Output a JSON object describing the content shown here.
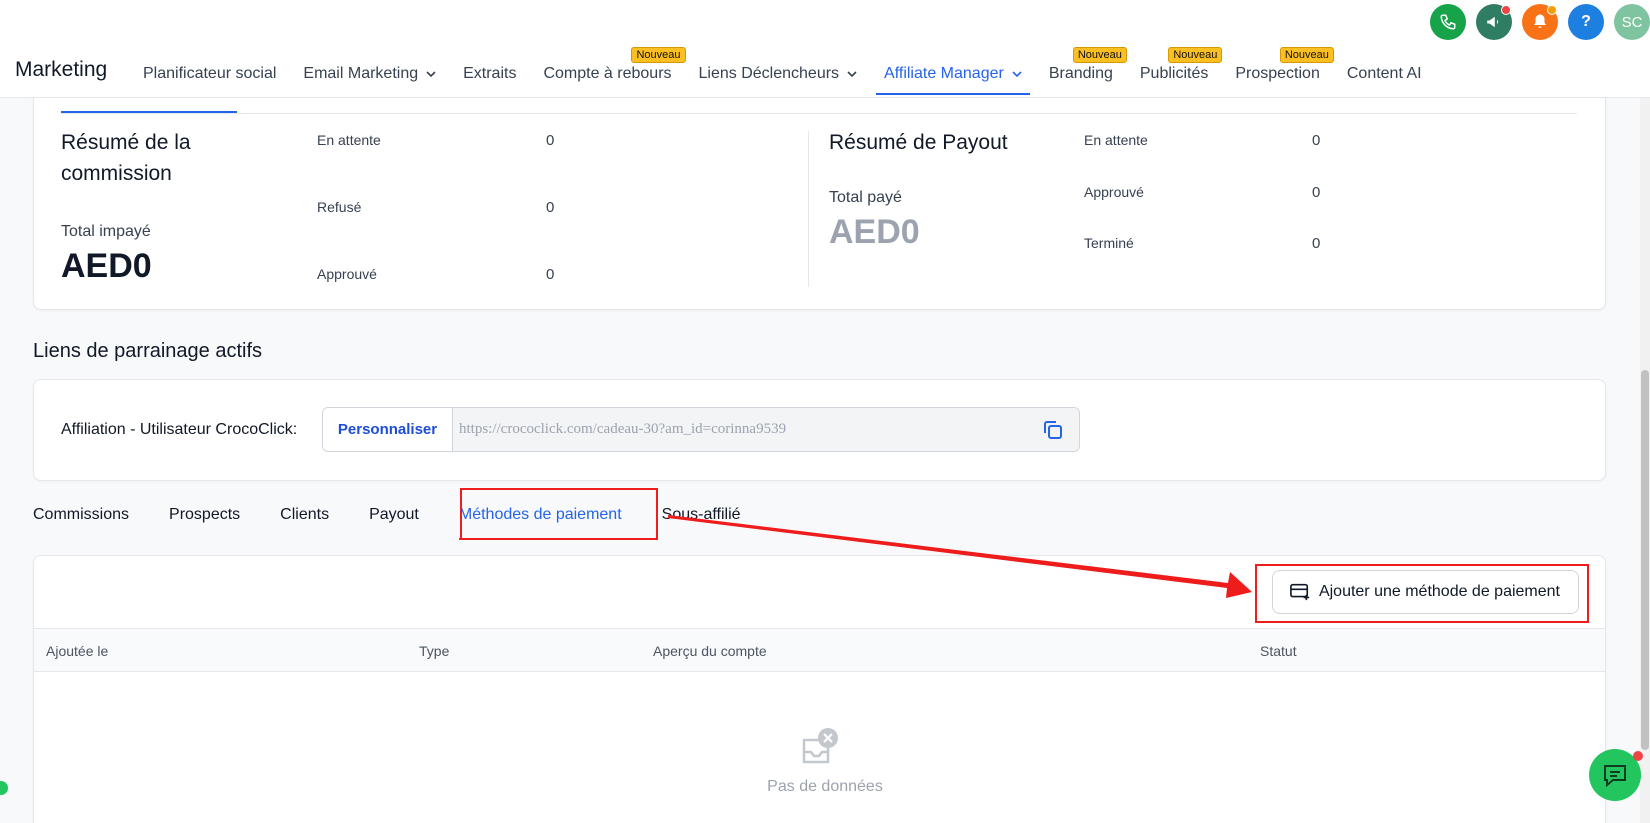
{
  "header": {
    "app_title": "Marketing",
    "nav": [
      {
        "label": "Planificateur social",
        "badge": "",
        "has_chevron": false,
        "active": false
      },
      {
        "label": "Email Marketing",
        "badge": "",
        "has_chevron": true,
        "active": false
      },
      {
        "label": "Extraits",
        "badge": "",
        "has_chevron": false,
        "active": false
      },
      {
        "label": "Compte à rebours",
        "badge": "Nouveau",
        "has_chevron": false,
        "active": false
      },
      {
        "label": "Liens Déclencheurs",
        "badge": "",
        "has_chevron": true,
        "active": false
      },
      {
        "label": "Affiliate Manager",
        "badge": "",
        "has_chevron": true,
        "active": true
      },
      {
        "label": "Branding",
        "badge": "Nouveau",
        "has_chevron": false,
        "active": false
      },
      {
        "label": "Publicités",
        "badge": "Nouveau",
        "has_chevron": false,
        "active": false
      },
      {
        "label": "Prospection",
        "badge": "Nouveau",
        "has_chevron": false,
        "active": false
      },
      {
        "label": "Content AI",
        "badge": "",
        "has_chevron": false,
        "active": false
      }
    ],
    "top_icons": [
      {
        "name": "phone-icon",
        "color": "#16a34a"
      },
      {
        "name": "megaphone-icon",
        "color": "#2f7d63"
      },
      {
        "name": "bell-icon",
        "color": "#f97316"
      },
      {
        "name": "help-icon",
        "color": "#1d7fe0",
        "glyph": "?"
      },
      {
        "name": "avatar",
        "color": "#7fc4a0",
        "glyph": "SC"
      }
    ]
  },
  "commission_summary": {
    "title": "Résumé de la commission",
    "total_label": "Total impayé",
    "total_value": "AED0",
    "rows": [
      {
        "label": "En attente",
        "value": "0"
      },
      {
        "label": "Refusé",
        "value": "0"
      },
      {
        "label": "Approuvé",
        "value": "0"
      }
    ]
  },
  "payout_summary": {
    "title": "Résumé de Payout",
    "total_label": "Total payé",
    "total_value": "AED0",
    "rows": [
      {
        "label": "En attente",
        "value": "0"
      },
      {
        "label": "Approuvé",
        "value": "0"
      },
      {
        "label": "Terminé",
        "value": "0"
      }
    ]
  },
  "referral": {
    "section_title": "Liens de parrainage actifs",
    "label": "Affiliation - Utilisateur CrocoClick:",
    "customize_label": "Personnaliser",
    "link": "https://crococlick.com/cadeau-30?am_id=corinna9539"
  },
  "tabs": [
    {
      "label": "Commissions",
      "active": false
    },
    {
      "label": "Prospects",
      "active": false
    },
    {
      "label": "Clients",
      "active": false
    },
    {
      "label": "Payout",
      "active": false
    },
    {
      "label": "Méthodes de paiement",
      "active": true
    },
    {
      "label": "Sous-affilié",
      "active": false
    }
  ],
  "payment_methods": {
    "add_button_label": "Ajouter une méthode de paiement",
    "columns": [
      "Ajoutée le",
      "Type",
      "Aperçu du compte",
      "Statut"
    ],
    "empty_text": "Pas de données"
  },
  "colors": {
    "accent": "#2563eb",
    "annotation": "#ef1c1c",
    "badge": "#fbbf24"
  }
}
